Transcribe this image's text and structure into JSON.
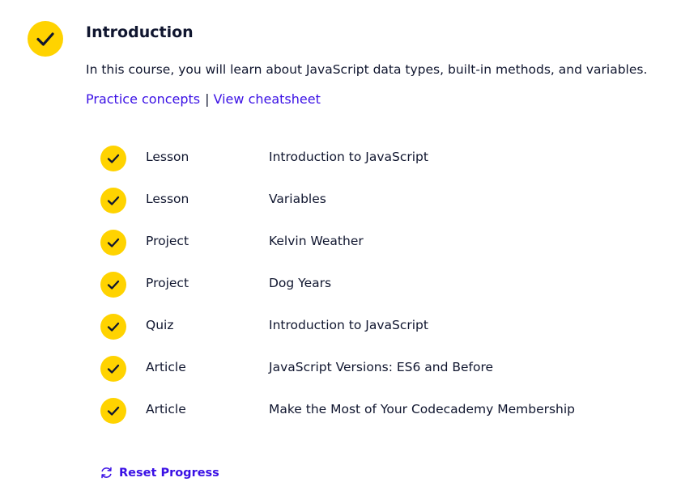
{
  "module": {
    "title": "Introduction",
    "description": "In this course, you will learn about JavaScript data types, built-in methods, and variables.",
    "completed": true,
    "icon": "checkmark-icon"
  },
  "links": {
    "practice": "Practice concepts",
    "separator": "|",
    "cheatsheet": "View cheatsheet"
  },
  "items": [
    {
      "type": "Lesson",
      "name": "Introduction to JavaScript"
    },
    {
      "type": "Lesson",
      "name": "Variables"
    },
    {
      "type": "Project",
      "name": "Kelvin Weather"
    },
    {
      "type": "Project",
      "name": "Dog Years"
    },
    {
      "type": "Quiz",
      "name": "Introduction to JavaScript"
    },
    {
      "type": "Article",
      "name": "JavaScript Versions: ES6 and Before"
    },
    {
      "type": "Article",
      "name": "Make the Most of Your Codecademy Membership"
    }
  ],
  "reset": {
    "label": "Reset Progress",
    "icon": "refresh-icon"
  },
  "colors": {
    "check_fill": "#ffd300",
    "text": "#10162f",
    "link": "#3a10e5"
  }
}
